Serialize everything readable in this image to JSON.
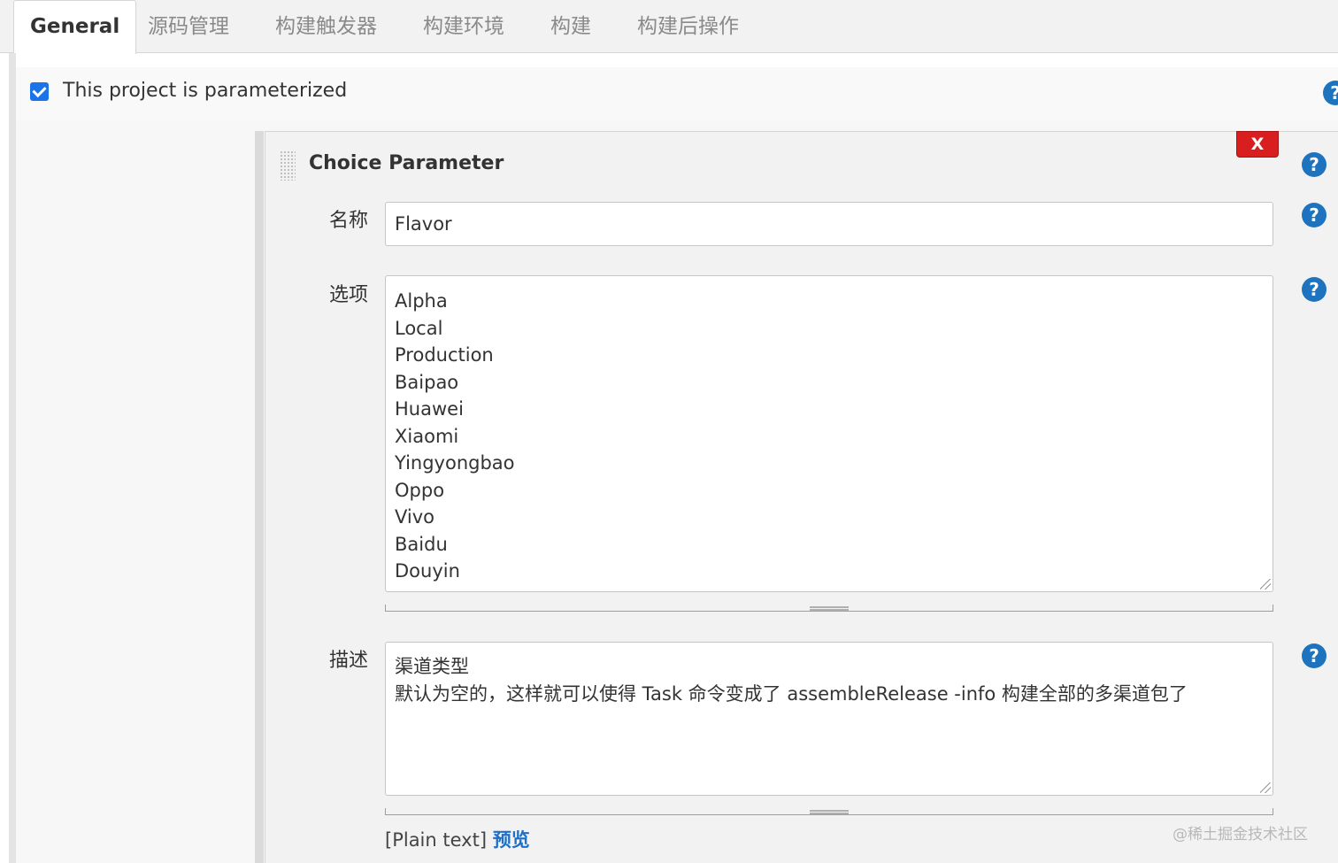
{
  "tabs": [
    {
      "label": "General",
      "active": true
    },
    {
      "label": "源码管理"
    },
    {
      "label": "构建触发器"
    },
    {
      "label": "构建环境"
    },
    {
      "label": "构建"
    },
    {
      "label": "构建后操作"
    }
  ],
  "parameterized": {
    "label": "This project is parameterized",
    "checked": true
  },
  "choice_parameter": {
    "title": "Choice Parameter",
    "delete_label": "X",
    "name_label": "名称",
    "name_value": "Flavor",
    "choices_label": "选项",
    "choices": [
      "Alpha",
      "Local",
      "Production",
      "Baipao",
      "Huawei",
      "Xiaomi",
      "Yingyongbao",
      "Oppo",
      "Vivo",
      "Baidu",
      "Douyin"
    ],
    "description_label": "描述",
    "description_lines": [
      "渠道类型",
      "默认为空的，这样就可以使得 Task 命令变成了 assembleRelease -info 构建全部的多渠道包了"
    ],
    "plain_text_label": "[Plain text]",
    "preview_label": "预览"
  },
  "help_label": "?",
  "watermark": "@稀土掘金技术社区",
  "colors": {
    "accent": "#1e73be",
    "delete": "#d81e1e",
    "checkbox": "#1a73e8"
  }
}
